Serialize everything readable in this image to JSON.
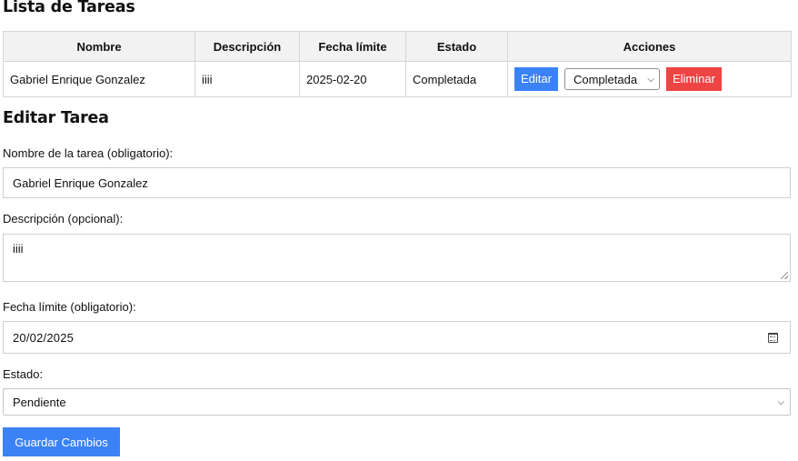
{
  "list": {
    "title": "Lista de Tareas",
    "columns": [
      "Nombre",
      "Descripción",
      "Fecha límite",
      "Estado",
      "Acciones"
    ],
    "rows": [
      {
        "nombre": "Gabriel Enrique Gonzalez",
        "descripcion": "iiii",
        "fecha": "2025-02-20",
        "estado": "Completada",
        "edit_label": "Editar",
        "status_select": "Completada",
        "delete_label": "Eliminar"
      }
    ]
  },
  "edit": {
    "title": "Editar Tarea",
    "name_label": "Nombre de la tarea (obligatorio):",
    "name_value": "Gabriel Enrique Gonzalez",
    "desc_label": "Descripción (opcional):",
    "desc_value": "iiii",
    "date_label": "Fecha límite (obligatorio):",
    "date_value": "20/02/2025",
    "status_label": "Estado:",
    "status_value": "Pendiente",
    "save_label": "Guardar Cambios"
  },
  "colors": {
    "primary": "#3b82f6",
    "danger": "#ef4444",
    "header_bg": "#f2f2f2"
  },
  "icons": {
    "calendar": "calendar-icon",
    "select_arrow": "chevron-down-icon"
  }
}
